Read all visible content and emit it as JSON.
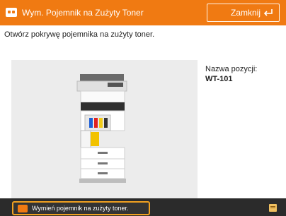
{
  "header": {
    "title": "Wym. Pojemnik na Zużyty Toner",
    "close_label": "Zamknij",
    "icon": "toner-warning-icon",
    "accent": "#f07a12"
  },
  "instruction": "Otwórz pokrywę pojemnika na zużyty toner.",
  "item": {
    "label": "Nazwa pozycji:",
    "value": "WT-101"
  },
  "illustration": {
    "icon": "printer-illustration"
  },
  "footer": {
    "status": "Wymień pojemnik na zużyty toner.",
    "status_icon": "toner-warning-icon",
    "log_icon": "status-log-icon"
  }
}
